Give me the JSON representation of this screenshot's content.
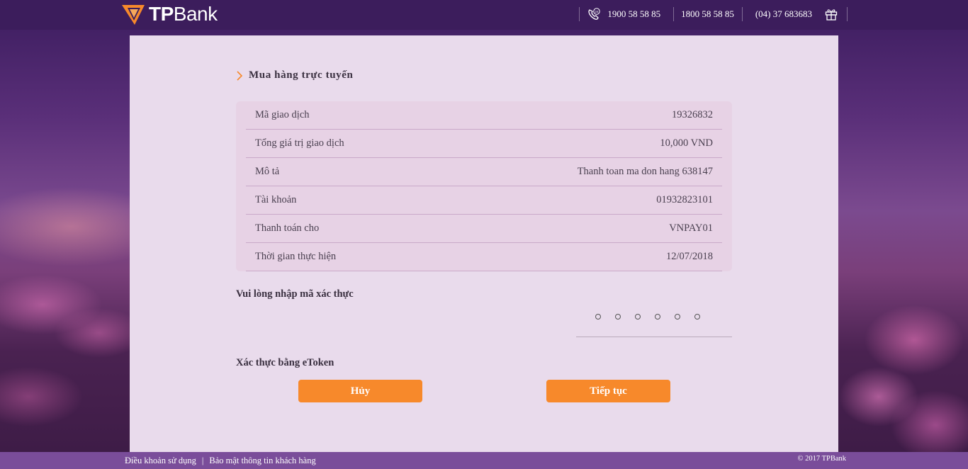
{
  "header": {
    "brand": {
      "prefix": "TP",
      "suffix": "Bank"
    },
    "hotlines": [
      "1900 58 58 85",
      "1800 58 58 85",
      "(04) 37 683683"
    ],
    "icons": [
      "phone-24h-icon",
      "gift-icon"
    ],
    "colors": {
      "bar": "#3c1d5c",
      "logo_orange": "#f7892b"
    }
  },
  "section": {
    "title": "Mua hàng trực tuyến"
  },
  "transaction": {
    "rows": [
      {
        "label": "Mã giao dịch",
        "value": "19326832"
      },
      {
        "label": "Tổng giá trị giao dịch",
        "value": "10,000 VND"
      },
      {
        "label": "Mô tả",
        "value": "Thanh toan ma don hang 638147"
      },
      {
        "label": "Tài khoản",
        "value": "01932823101"
      },
      {
        "label": "Thanh toán cho",
        "value": "VNPAY01"
      },
      {
        "label": "Thời gian thực hiện",
        "value": "12/07/2018"
      }
    ]
  },
  "otp": {
    "label": "Vui lòng nhập mã xác thực",
    "digits": 6
  },
  "etoken": {
    "label": "Xác thực bằng eToken"
  },
  "buttons": {
    "cancel": "Hủy",
    "next": "Tiếp tục",
    "color": "#f7892b"
  },
  "footer": {
    "terms": "Điều khoản sử dụng",
    "divider": "|",
    "privacy": "Bảo mật thông tin khách hàng",
    "copyright": "© 2017 TPBank"
  }
}
